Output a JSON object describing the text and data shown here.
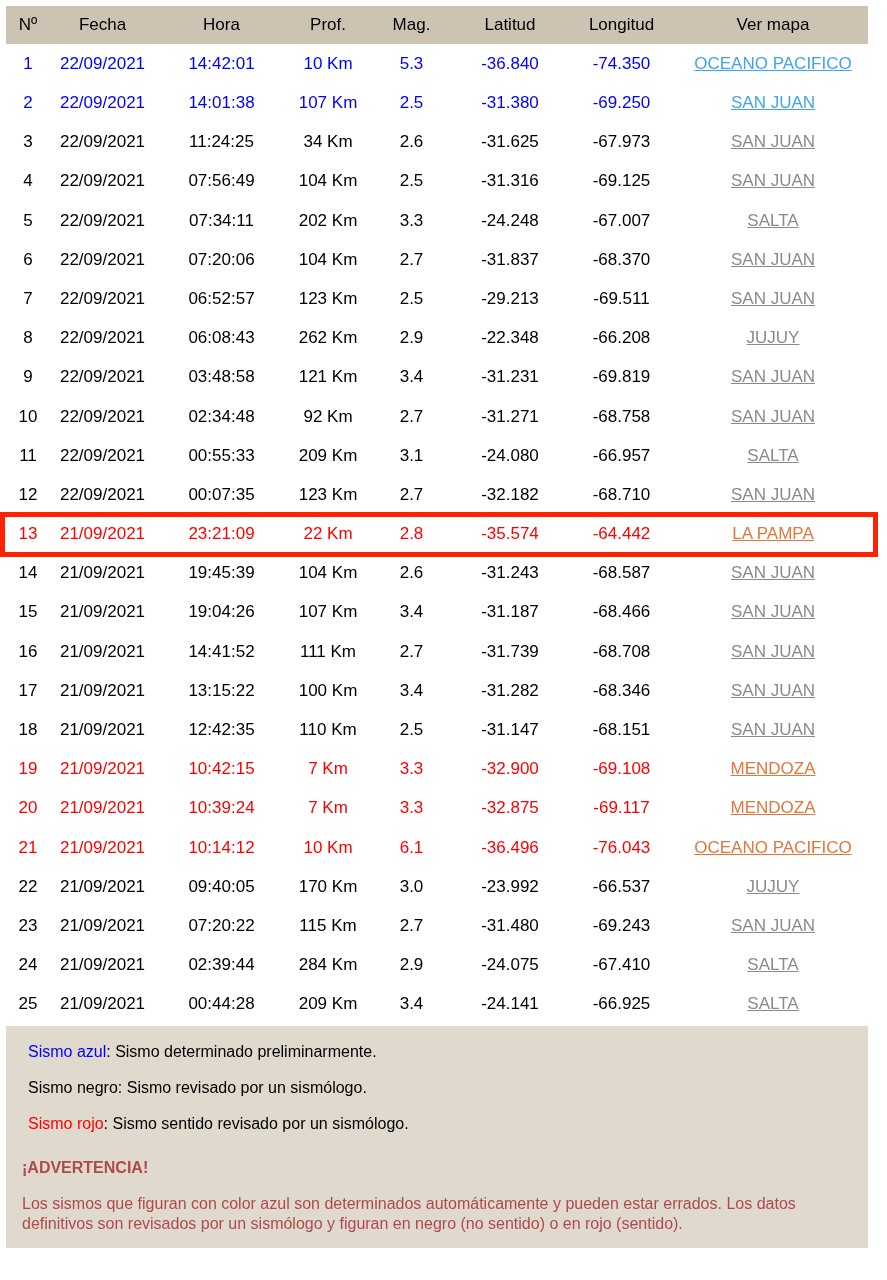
{
  "table": {
    "columns": [
      "Nº",
      "Fecha",
      "Hora",
      "Prof.",
      "Mag.",
      "Latitud",
      "Longitud",
      "Ver mapa"
    ],
    "rows": [
      {
        "kind": "blue",
        "highlighted": false,
        "cells": [
          "1",
          "22/09/2021",
          "14:42:01",
          "10 Km",
          "5.3",
          "-36.840",
          "-74.350"
        ],
        "map_link": "OCEANO PACIFICO"
      },
      {
        "kind": "blue",
        "highlighted": false,
        "cells": [
          "2",
          "22/09/2021",
          "14:01:38",
          "107 Km",
          "2.5",
          "-31.380",
          "-69.250"
        ],
        "map_link": "SAN JUAN"
      },
      {
        "kind": "black",
        "highlighted": false,
        "cells": [
          "3",
          "22/09/2021",
          "11:24:25",
          "34 Km",
          "2.6",
          "-31.625",
          "-67.973"
        ],
        "map_link": "SAN JUAN"
      },
      {
        "kind": "black",
        "highlighted": false,
        "cells": [
          "4",
          "22/09/2021",
          "07:56:49",
          "104 Km",
          "2.5",
          "-31.316",
          "-69.125"
        ],
        "map_link": "SAN JUAN"
      },
      {
        "kind": "black",
        "highlighted": false,
        "cells": [
          "5",
          "22/09/2021",
          "07:34:11",
          "202 Km",
          "3.3",
          "-24.248",
          "-67.007"
        ],
        "map_link": "SALTA"
      },
      {
        "kind": "black",
        "highlighted": false,
        "cells": [
          "6",
          "22/09/2021",
          "07:20:06",
          "104 Km",
          "2.7",
          "-31.837",
          "-68.370"
        ],
        "map_link": "SAN JUAN"
      },
      {
        "kind": "black",
        "highlighted": false,
        "cells": [
          "7",
          "22/09/2021",
          "06:52:57",
          "123 Km",
          "2.5",
          "-29.213",
          "-69.511"
        ],
        "map_link": "SAN JUAN"
      },
      {
        "kind": "black",
        "highlighted": false,
        "cells": [
          "8",
          "22/09/2021",
          "06:08:43",
          "262 Km",
          "2.9",
          "-22.348",
          "-66.208"
        ],
        "map_link": "JUJUY"
      },
      {
        "kind": "black",
        "highlighted": false,
        "cells": [
          "9",
          "22/09/2021",
          "03:48:58",
          "121 Km",
          "3.4",
          "-31.231",
          "-69.819"
        ],
        "map_link": "SAN JUAN"
      },
      {
        "kind": "black",
        "highlighted": false,
        "cells": [
          "10",
          "22/09/2021",
          "02:34:48",
          "92 Km",
          "2.7",
          "-31.271",
          "-68.758"
        ],
        "map_link": "SAN JUAN"
      },
      {
        "kind": "black",
        "highlighted": false,
        "cells": [
          "11",
          "22/09/2021",
          "00:55:33",
          "209 Km",
          "3.1",
          "-24.080",
          "-66.957"
        ],
        "map_link": "SALTA"
      },
      {
        "kind": "black",
        "highlighted": false,
        "cells": [
          "12",
          "22/09/2021",
          "00:07:35",
          "123 Km",
          "2.7",
          "-32.182",
          "-68.710"
        ],
        "map_link": "SAN JUAN"
      },
      {
        "kind": "red",
        "highlighted": true,
        "cells": [
          "13",
          "21/09/2021",
          "23:21:09",
          "22 Km",
          "2.8",
          "-35.574",
          "-64.442"
        ],
        "map_link": "LA PAMPA"
      },
      {
        "kind": "black",
        "highlighted": false,
        "cells": [
          "14",
          "21/09/2021",
          "19:45:39",
          "104 Km",
          "2.6",
          "-31.243",
          "-68.587"
        ],
        "map_link": "SAN JUAN"
      },
      {
        "kind": "black",
        "highlighted": false,
        "cells": [
          "15",
          "21/09/2021",
          "19:04:26",
          "107 Km",
          "3.4",
          "-31.187",
          "-68.466"
        ],
        "map_link": "SAN JUAN"
      },
      {
        "kind": "black",
        "highlighted": false,
        "cells": [
          "16",
          "21/09/2021",
          "14:41:52",
          "111 Km",
          "2.7",
          "-31.739",
          "-68.708"
        ],
        "map_link": "SAN JUAN"
      },
      {
        "kind": "black",
        "highlighted": false,
        "cells": [
          "17",
          "21/09/2021",
          "13:15:22",
          "100 Km",
          "3.4",
          "-31.282",
          "-68.346"
        ],
        "map_link": "SAN JUAN"
      },
      {
        "kind": "black",
        "highlighted": false,
        "cells": [
          "18",
          "21/09/2021",
          "12:42:35",
          "110 Km",
          "2.5",
          "-31.147",
          "-68.151"
        ],
        "map_link": "SAN JUAN"
      },
      {
        "kind": "red",
        "highlighted": false,
        "cells": [
          "19",
          "21/09/2021",
          "10:42:15",
          "7 Km",
          "3.3",
          "-32.900",
          "-69.108"
        ],
        "map_link": "MENDOZA"
      },
      {
        "kind": "red",
        "highlighted": false,
        "cells": [
          "20",
          "21/09/2021",
          "10:39:24",
          "7 Km",
          "3.3",
          "-32.875",
          "-69.117"
        ],
        "map_link": "MENDOZA"
      },
      {
        "kind": "red",
        "highlighted": false,
        "cells": [
          "21",
          "21/09/2021",
          "10:14:12",
          "10 Km",
          "6.1",
          "-36.496",
          "-76.043"
        ],
        "map_link": "OCEANO PACIFICO"
      },
      {
        "kind": "black",
        "highlighted": false,
        "cells": [
          "22",
          "21/09/2021",
          "09:40:05",
          "170 Km",
          "3.0",
          "-23.992",
          "-66.537"
        ],
        "map_link": "JUJUY"
      },
      {
        "kind": "black",
        "highlighted": false,
        "cells": [
          "23",
          "21/09/2021",
          "07:20:22",
          "115 Km",
          "2.7",
          "-31.480",
          "-69.243"
        ],
        "map_link": "SAN JUAN"
      },
      {
        "kind": "black",
        "highlighted": false,
        "cells": [
          "24",
          "21/09/2021",
          "02:39:44",
          "284 Km",
          "2.9",
          "-24.075",
          "-67.410"
        ],
        "map_link": "SALTA"
      },
      {
        "kind": "black",
        "highlighted": false,
        "cells": [
          "25",
          "21/09/2021",
          "00:44:28",
          "209 Km",
          "3.4",
          "-24.141",
          "-66.925"
        ],
        "map_link": "SALTA"
      }
    ]
  },
  "legend": {
    "items": [
      {
        "kind": "blue",
        "term": "Sismo azul",
        "text": ": Sismo determinado preliminarmente."
      },
      {
        "kind": "black",
        "term": "Sismo negro",
        "text": ": Sismo revisado por un sismólogo."
      },
      {
        "kind": "red",
        "term": "Sismo rojo",
        "text": ": Sismo sentido revisado por un sismólogo."
      }
    ],
    "warning_title": "¡ADVERTENCIA!",
    "warning_text": "Los sismos que figuran con color azul son determinados automáticamente y pueden estar errados. Los datos definitivos son revisados por un sismólogo y figuran en negro (no sentido) o en rojo (sentido)."
  }
}
